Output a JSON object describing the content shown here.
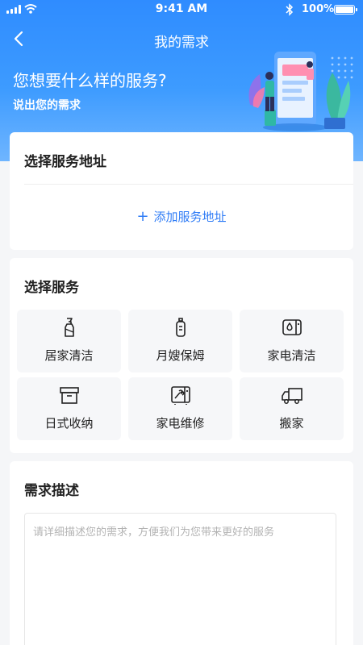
{
  "status_bar": {
    "time": "9:41 AM",
    "battery": "100%"
  },
  "nav": {
    "title": "我的需求"
  },
  "hero": {
    "headline": "您想要什么样的服务?",
    "subline": "说出您的需求"
  },
  "address": {
    "title": "选择服务地址",
    "add_label": "添加服务地址"
  },
  "services": {
    "title": "选择服务",
    "items": [
      {
        "label": "居家清洁",
        "icon": "spray-bottle-icon"
      },
      {
        "label": "月嫂保姆",
        "icon": "baby-bottle-icon"
      },
      {
        "label": "家电清洁",
        "icon": "washing-machine-icon"
      },
      {
        "label": "日式收纳",
        "icon": "storage-box-icon"
      },
      {
        "label": "家电维修",
        "icon": "appliance-repair-icon"
      },
      {
        "label": "搬家",
        "icon": "moving-truck-icon"
      }
    ]
  },
  "description": {
    "title": "需求描述",
    "placeholder": "请详细描述您的需求，方便我们为您带来更好的服务"
  },
  "colors": {
    "primary": "#2f8cff",
    "link": "#2f7cf6",
    "page_bg": "#f5f6f8"
  }
}
